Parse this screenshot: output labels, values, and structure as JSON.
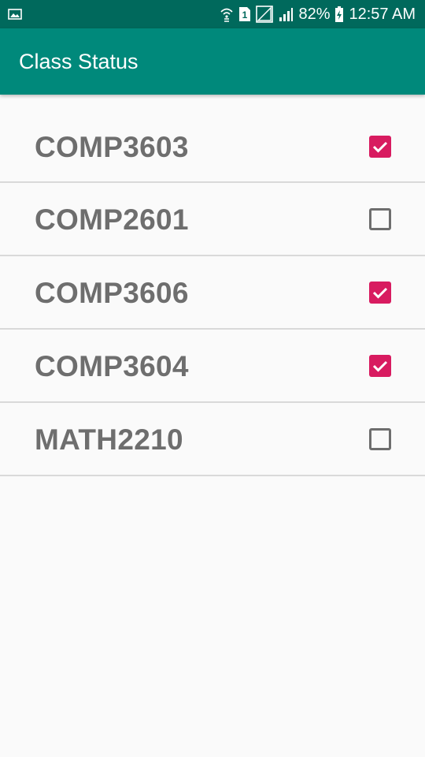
{
  "status_bar": {
    "battery_percent": "82%",
    "time": "12:57 AM",
    "sim_slot": "1",
    "icons": [
      "gallery-icon",
      "wifi-calling-icon",
      "sim-1-icon",
      "no-signal-icon",
      "signal-icon",
      "battery-charging-icon"
    ]
  },
  "app_bar": {
    "title": "Class Status"
  },
  "courses": [
    {
      "label": "COMP3603",
      "checked": true
    },
    {
      "label": "COMP2601",
      "checked": false
    },
    {
      "label": "COMP3606",
      "checked": true
    },
    {
      "label": "COMP3604",
      "checked": true
    },
    {
      "label": "MATH2210",
      "checked": false
    }
  ],
  "colors": {
    "status_bar": "#00695c",
    "app_bar": "#00897b",
    "checkbox_checked": "#d81b60",
    "label_text": "#6e6e6e",
    "background": "#fafafa"
  }
}
